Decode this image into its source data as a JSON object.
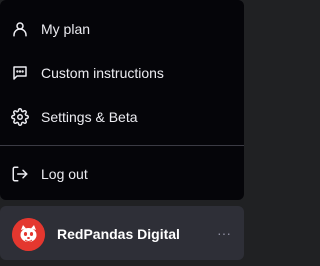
{
  "menu": {
    "items": [
      {
        "label": "My plan",
        "icon": "user-icon"
      },
      {
        "label": "Custom instructions",
        "icon": "message-icon"
      },
      {
        "label": "Settings & Beta",
        "icon": "gear-icon"
      },
      {
        "label": "Log out",
        "icon": "logout-icon"
      }
    ]
  },
  "account": {
    "name": "RedPandas Digital",
    "avatar_icon": "red-panda-logo",
    "avatar_color": "#e4372f",
    "more_icon": "ellipsis-icon",
    "more_glyph": "···"
  }
}
